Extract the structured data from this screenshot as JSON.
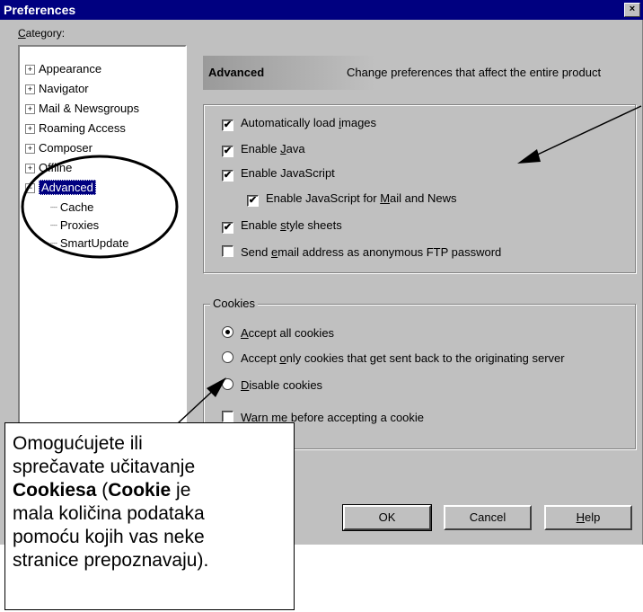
{
  "window": {
    "title": "Preferences",
    "close_glyph": "×"
  },
  "category": {
    "label_prefix": "C",
    "label_rest": "ategory:",
    "tree": [
      {
        "label": "Appearance"
      },
      {
        "label": "Navigator"
      },
      {
        "label": "Mail & Newsgroups"
      },
      {
        "label": "Roaming Access"
      },
      {
        "label": "Composer"
      },
      {
        "label": "Offline"
      },
      {
        "label": "Advanced",
        "selected": true
      }
    ],
    "children": [
      {
        "label": "Cache"
      },
      {
        "label": "Proxies"
      },
      {
        "label": "SmartUpdate"
      }
    ]
  },
  "panel": {
    "title": "Advanced",
    "description": "Change preferences that affect the entire product"
  },
  "options": [
    {
      "pre": "Automatically load ",
      "key": "i",
      "post": "mages",
      "checked": true
    },
    {
      "pre": "Enable ",
      "key": "J",
      "post": "ava",
      "checked": true
    },
    {
      "pre": "Enable JavaScript",
      "key": "",
      "post": "",
      "checked": true
    },
    {
      "pre": "Enable JavaScript for ",
      "key": "M",
      "post": "ail and News",
      "checked": true
    },
    {
      "pre": "Enable ",
      "key": "s",
      "post": "tyle sheets",
      "checked": true
    },
    {
      "pre": "Send ",
      "key": "e",
      "post": "mail address as anonymous FTP password",
      "checked": false
    }
  ],
  "cookies": {
    "group_label": "Cookies",
    "options": [
      {
        "pre": "",
        "key": "A",
        "post": "ccept all cookies",
        "selected": true
      },
      {
        "pre": "Accept ",
        "key": "o",
        "post": "nly cookies that get sent back to the originating server",
        "selected": false
      },
      {
        "pre": "",
        "key": "D",
        "post": "isable cookies",
        "selected": false
      }
    ],
    "warn": {
      "pre": "",
      "key": "W",
      "post": "arn me before accepting a cookie",
      "checked": false
    }
  },
  "buttons": {
    "ok": "OK",
    "cancel": "Cancel",
    "help_key": "H",
    "help_rest": "elp"
  },
  "check_glyph": "✔",
  "callout": {
    "line1": "Omogućujete ili",
    "line2": "sprečavate učitavanje",
    "bold1": "Cookiesa",
    "open": " (",
    "bold2": "Cookie",
    "rest1": " je",
    "line4": "mala količina podataka",
    "line5": "pomoću kojih vas neke",
    "line6": "stranice prepoznavaju)."
  }
}
